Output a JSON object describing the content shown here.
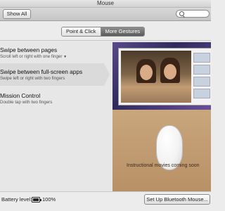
{
  "window": {
    "title": "Mouse"
  },
  "toolbar": {
    "show_all_label": "Show All",
    "search_placeholder": ""
  },
  "tabs": [
    {
      "label": "Point & Click",
      "active": false
    },
    {
      "label": "More Gestures",
      "active": true
    }
  ],
  "gestures": [
    {
      "title": "Swipe between pages",
      "subtitle": "Scroll left or right with one finger",
      "has_dropdown": true
    },
    {
      "title": "Swipe between full-screen apps",
      "subtitle": "Swipe left or right with two fingers",
      "selected": true
    },
    {
      "title": "Mission Control",
      "subtitle": "Double tap with two fingers"
    }
  ],
  "preview": {
    "caption": "Instructional movies coming soon"
  },
  "status": {
    "battery_label": "Battery level:",
    "battery_value": "100%"
  },
  "buttons": {
    "setup_bluetooth": "Set Up Bluetooth Mouse..."
  },
  "colors": {
    "selected_tab": "#6b6b6b",
    "window_bg": "#ececec",
    "desk": "#c19c72"
  }
}
